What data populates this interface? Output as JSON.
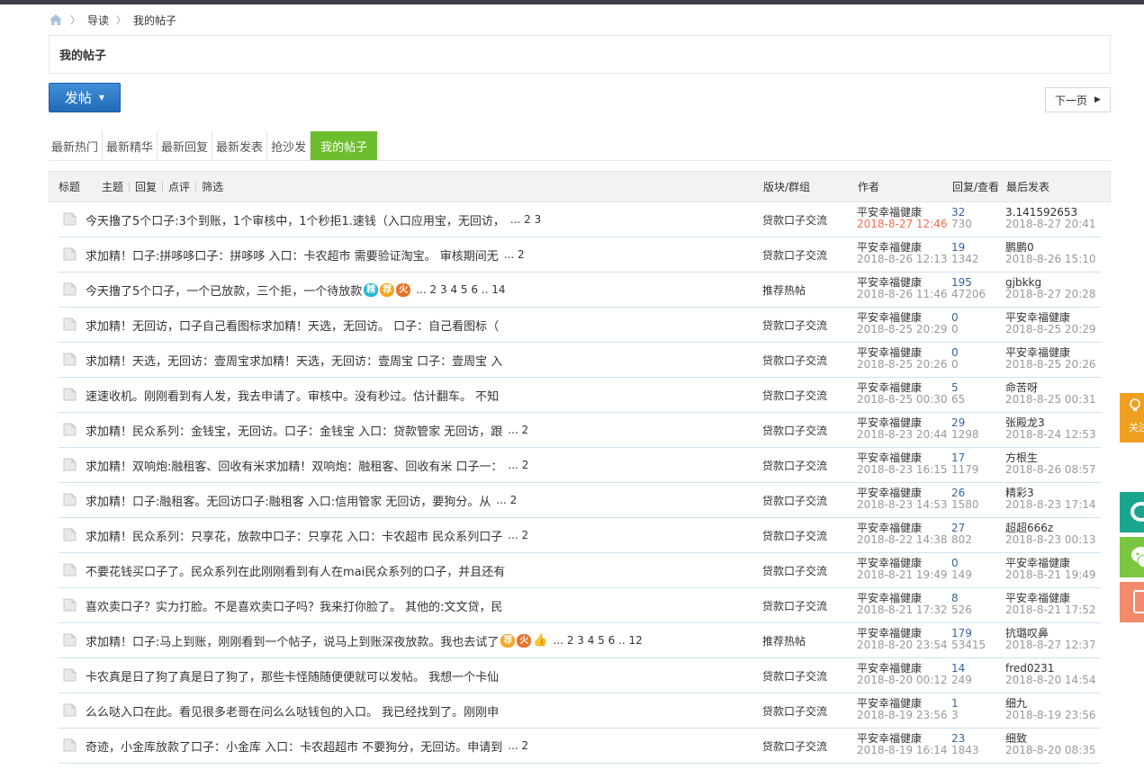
{
  "breadcrumb": {
    "items": [
      "导读",
      "我的帖子"
    ]
  },
  "page_title": "我的帖子",
  "toolbar": {
    "post_label": "发帖",
    "next_label": "下一页"
  },
  "tabs": [
    "最新热门",
    "最新精华",
    "最新回复",
    "最新发表",
    "抢沙发",
    "我的帖子"
  ],
  "table_header": {
    "title": "标题",
    "filters": [
      "主题",
      "回复",
      "点评",
      "筛选"
    ],
    "forum": "版块/群组",
    "author": "作者",
    "stats": "回复/查看",
    "last": "最后发表"
  },
  "side": {
    "follow_label": "关注"
  },
  "badges": {
    "jing": "精",
    "jian": "荐",
    "huo": "火"
  },
  "rows": [
    {
      "subject": "今天撸了5个口子:3个到账，1个审核中，1个秒拒1.速钱（入口应用宝，无回访，",
      "pages": "... 2  3",
      "forum": "贷款口子交流",
      "author": "平安幸福健康",
      "date": "2018-8-27 12:46",
      "replies": "32",
      "views": "730",
      "last_user": "3.141592653",
      "last_date": "2018-8-27 20:41"
    },
    {
      "subject": "求加精！口子:拼哆哆口子：拼哆哆 入口：卡农超市 需要验证淘宝。 审核期间无",
      "pages": "... 2",
      "forum": "贷款口子交流",
      "author": "平安幸福健康",
      "date": "2018-8-26 12:13",
      "replies": "19",
      "views": "1342",
      "last_user": "鹏鹏0",
      "last_date": "2018-8-26 15:10"
    },
    {
      "subject": "今天撸了5个口子，一个已放款，三个拒，一个待放款",
      "pages": "... 2  3  4  5  6 .. 14",
      "forum": "推荐热帖",
      "author": "平安幸福健康",
      "date": "2018-8-26 11:46",
      "replies": "195",
      "views": "47206",
      "last_user": "gjbkkg",
      "last_date": "2018-8-27 20:28"
    },
    {
      "subject": "求加精！无回访，口子自己看图标求加精！天选，无回访。 口子：自己看图标（",
      "pages": "",
      "forum": "贷款口子交流",
      "author": "平安幸福健康",
      "date": "2018-8-25 20:29",
      "replies": "0",
      "views": "0",
      "last_user": "平安幸福健康",
      "last_date": "2018-8-25 20:29"
    },
    {
      "subject": "求加精！天选，无回访：壹周宝求加精！天选，无回访：壹周宝 口子：壹周宝 入",
      "pages": "",
      "forum": "贷款口子交流",
      "author": "平安幸福健康",
      "date": "2018-8-25 20:26",
      "replies": "0",
      "views": "0",
      "last_user": "平安幸福健康",
      "last_date": "2018-8-25 20:26"
    },
    {
      "subject": "速速收机。刚刚看到有人发，我去申请了。审核中。没有秒过。估计翻车。 不知",
      "pages": "",
      "forum": "贷款口子交流",
      "author": "平安幸福健康",
      "date": "2018-8-25 00:30",
      "replies": "5",
      "views": "65",
      "last_user": "命苦呀",
      "last_date": "2018-8-25 00:31"
    },
    {
      "subject": "求加精！民众系列：金钱宝，无回访。口子：金钱宝 入口：贷款管家 无回访，跟",
      "pages": "... 2",
      "forum": "贷款口子交流",
      "author": "平安幸福健康",
      "date": "2018-8-23 20:44",
      "replies": "29",
      "views": "1298",
      "last_user": "张殿龙3",
      "last_date": "2018-8-24 12:53"
    },
    {
      "subject": "求加精！双响炮:融租客、回收有米求加精！双响炮：融租客、回收有米 口子一：",
      "pages": "... 2",
      "forum": "贷款口子交流",
      "author": "平安幸福健康",
      "date": "2018-8-23 16:15",
      "replies": "17",
      "views": "1179",
      "last_user": "方根生",
      "last_date": "2018-8-26 08:57"
    },
    {
      "subject": "求加精！口子:融租客。无回访口子:融租客 入口:信用管家 无回访，要狗分。从",
      "pages": "... 2",
      "forum": "贷款口子交流",
      "author": "平安幸福健康",
      "date": "2018-8-23 14:53",
      "replies": "26",
      "views": "1580",
      "last_user": "精彩3",
      "last_date": "2018-8-23 17:14"
    },
    {
      "subject": "求加精！民众系列：只享花，放款中口子：只享花 入口：卡农超市 民众系列口子",
      "pages": "... 2",
      "forum": "贷款口子交流",
      "author": "平安幸福健康",
      "date": "2018-8-22 14:38",
      "replies": "27",
      "views": "802",
      "last_user": "超超666z",
      "last_date": "2018-8-23 00:13"
    },
    {
      "subject": "不要花钱买口子了。民众系列在此刚刚看到有人在mai民众系列的口子，并且还有",
      "pages": "",
      "forum": "贷款口子交流",
      "author": "平安幸福健康",
      "date": "2018-8-21 19:49",
      "replies": "0",
      "views": "149",
      "last_user": "平安幸福健康",
      "last_date": "2018-8-21 19:49"
    },
    {
      "subject": "喜欢卖口子？实力打脸。不是喜欢卖口子吗？我来打你脸了。 其他的:文文贷，民",
      "pages": "",
      "forum": "贷款口子交流",
      "author": "平安幸福健康",
      "date": "2018-8-21 17:32",
      "replies": "8",
      "views": "526",
      "last_user": "平安幸福健康",
      "last_date": "2018-8-21 17:52"
    },
    {
      "subject": "求加精！口子:马上到账，刚刚看到一个帖子，说马上到账深夜放款。我也去试了",
      "pages": "... 2  3  4  5  6 .. 12",
      "forum": "推荐热帖",
      "author": "平安幸福健康",
      "date": "2018-8-20 23:54",
      "replies": "179",
      "views": "53415",
      "last_user": "抗璐叹鼻",
      "last_date": "2018-8-27 12:37"
    },
    {
      "subject": "卡农真是日了狗了真是日了狗了，那些卡怪随随便便就可以发帖。 我想一个卡仙",
      "pages": "",
      "forum": "贷款口子交流",
      "author": "平安幸福健康",
      "date": "2018-8-20 00:12",
      "replies": "14",
      "views": "249",
      "last_user": "fred0231",
      "last_date": "2018-8-20 14:54"
    },
    {
      "subject": "么么哒入口在此。看见很多老哥在问么么哒钱包的入口。 我已经找到了。刚刚申",
      "pages": "",
      "forum": "贷款口子交流",
      "author": "平安幸福健康",
      "date": "2018-8-19 23:56",
      "replies": "1",
      "views": "3",
      "last_user": "细九",
      "last_date": "2018-8-19 23:56"
    },
    {
      "subject": "奇迹，小金库放款了口子：小金库 入口：卡农超超市 不要狗分，无回访。申请到",
      "pages": "... 2",
      "forum": "贷款口子交流",
      "author": "平安幸福健康",
      "date": "2018-8-19 16:14",
      "replies": "23",
      "views": "1843",
      "last_user": "细致",
      "last_date": "2018-8-20 08:35"
    }
  ]
}
